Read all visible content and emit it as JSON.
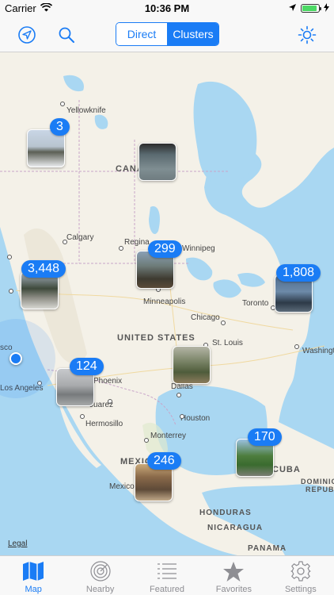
{
  "status_bar": {
    "carrier": "Carrier",
    "time": "10:36 PM"
  },
  "nav": {
    "segments": [
      "Direct",
      "Clusters"
    ],
    "active_segment": "Clusters",
    "accent_color": "#1a7cf5"
  },
  "map": {
    "legal": "Legal",
    "country_labels": [
      "CANADA",
      "UNITED STATES",
      "MEXICO",
      "CUBA",
      "DOMINICAN",
      "REPUB",
      "HONDURAS",
      "NICARAGUA",
      "PANAMA"
    ],
    "city_labels": [
      "Yellowknife",
      "Calgary",
      "Regina",
      "Winnipeg",
      "Minneapolis",
      "Toronto",
      "Chicago",
      "St. Louis",
      "Washington",
      "Dallas",
      "Houston",
      "Monterrey",
      "Hermosillo",
      "Phoenix",
      "Juarez",
      "Los Angeles",
      "sco",
      "Mexico"
    ],
    "clusters": [
      {
        "count": "3"
      },
      {
        "count": ""
      },
      {
        "count": "299"
      },
      {
        "count": "3,448"
      },
      {
        "count": "1,808"
      },
      {
        "count": ""
      },
      {
        "count": "124"
      },
      {
        "count": "170"
      },
      {
        "count": "246"
      }
    ]
  },
  "tabs": [
    {
      "label": "Map",
      "icon": "map-icon",
      "active": true
    },
    {
      "label": "Nearby",
      "icon": "radar-icon",
      "active": false
    },
    {
      "label": "Featured",
      "icon": "list-icon",
      "active": false
    },
    {
      "label": "Favorites",
      "icon": "star-icon",
      "active": false
    },
    {
      "label": "Settings",
      "icon": "gear-icon",
      "active": false
    }
  ]
}
